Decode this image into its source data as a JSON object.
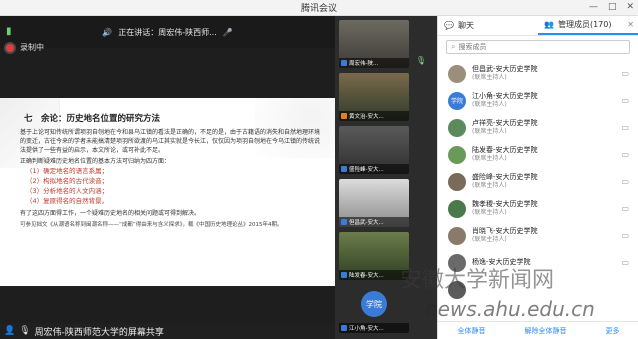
{
  "window": {
    "title": "腾讯会议"
  },
  "meeting": {
    "speaking_label": "正在讲话：周宏伟-陕西师...",
    "recording_label": "录制中",
    "share_label": "周宏伟-陕西师范大学的屏幕共享"
  },
  "slide": {
    "heading": "七　余论：历史地名位置的研究方法",
    "para1": "基于上论可知传统所谓项羽自刎地在今和县乌江镇的看法是正确的，不足的是，由于古籍语的消失和自然地理环境的变迁，古往今来的学者未能搞清楚项羽所欲渡的乌江其实就是今长江，仅仅因为项羽自刎地在今乌江镇的传统说法提供了一些有益的启示，本文所论，或可补此不足。",
    "para2": "正确判断疑难历史地名位置的基本方法可归纳为四方面：",
    "items": [
      "（1）确定地名的语言系属；",
      "（2）构拟地名的古代读音；",
      "（3）分析地名的人文内涵；",
      "（4）复原得名的自然背景。"
    ],
    "para3": "有了这四方面得工作，一个疑难历史地名的相关问题或可得到解决。",
    "note": "可参见拙文《从潮语名称到闽潮名称——“成都”得由来与含义探求》，载《中国历史地理论丛》2015年4期。"
  },
  "videos": [
    {
      "name": "周宏伟-陕..."
    },
    {
      "name": "黄文治-安大..."
    },
    {
      "name": "盛险峰-安大..."
    },
    {
      "name": "但昌武-安大..."
    },
    {
      "name": "陆发春-安大..."
    },
    {
      "name": "江小角-安大..."
    }
  ],
  "videos_avatar_label": "学院",
  "chat": {
    "tab_chat": "聊天",
    "tab_members": "管理成员(170)",
    "search_placeholder": "搜索成员",
    "participants": [
      {
        "name": "但昌武-安大历史学院",
        "role": "(联席主持人)",
        "avatar": ""
      },
      {
        "name": "江小角-安大历史学院",
        "role": "(联席主持人)",
        "avatar": "学院"
      },
      {
        "name": "卢祥亮-安大历史学院",
        "role": "(联席主持人)",
        "avatar": ""
      },
      {
        "name": "陆发春-安大历史学院",
        "role": "(联席主持人)",
        "avatar": ""
      },
      {
        "name": "盛险峰-安大历史学院",
        "role": "(联席主持人)",
        "avatar": ""
      },
      {
        "name": "魏孝稷-安大历史学院",
        "role": "(联席主持人)",
        "avatar": ""
      },
      {
        "name": "肖晓飞-安大历史学院",
        "role": "(联席主持人)",
        "avatar": ""
      },
      {
        "name": "杨逸-安大历史学院",
        "role": "",
        "avatar": ""
      },
      {
        "name": "",
        "role": "",
        "avatar": ""
      }
    ],
    "footer": {
      "mute_all": "全体静音",
      "unmute_all": "解除全体静音",
      "more": "更多"
    }
  },
  "watermark": {
    "line1": "安徽大学新闻网",
    "line2": "news.ahu.edu.cn"
  }
}
